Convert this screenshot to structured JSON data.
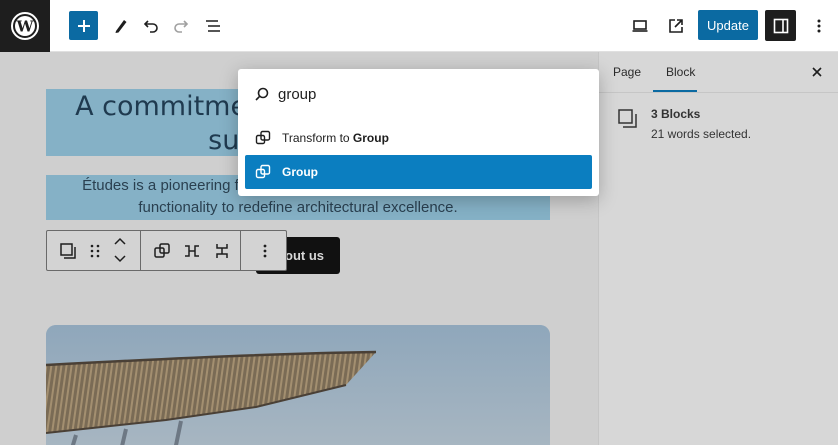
{
  "topbar": {
    "logo": "wordpress-logo",
    "update_label": "Update",
    "icons": [
      "plus-icon",
      "pencil-icon",
      "undo-icon",
      "redo-icon",
      "list-view-icon",
      "desktop-preview-icon",
      "external-link-icon",
      "sidebar-toggle-icon",
      "more-vertical-icon"
    ],
    "accent_color": "#0b6aa2"
  },
  "canvas": {
    "heading_lines": [
      "A commitment to innovation and",
      "sustainability"
    ],
    "paragraph_lines": [
      "Études is a pioneering firm that seamlessly merges creativity and",
      "functionality to redefine architectural excellence."
    ],
    "button_label": "About us"
  },
  "block_toolbar": {
    "icons": [
      "group-block-icon",
      "drag-handle-icon",
      "move-up-icon",
      "move-down-icon",
      "group-icon",
      "row-icon",
      "stack-icon",
      "options-icon"
    ]
  },
  "sidebar": {
    "tabs": [
      "Page",
      "Block"
    ],
    "active_tab": "Block",
    "close_icon": "close-icon",
    "block_title": "3 Blocks",
    "block_desc": "21 words selected."
  },
  "palette": {
    "search_value": "group",
    "items": [
      {
        "prefix": "Transform to ",
        "strong": "Group",
        "active": false
      },
      {
        "prefix": "",
        "strong": "Group",
        "active": true
      }
    ]
  }
}
